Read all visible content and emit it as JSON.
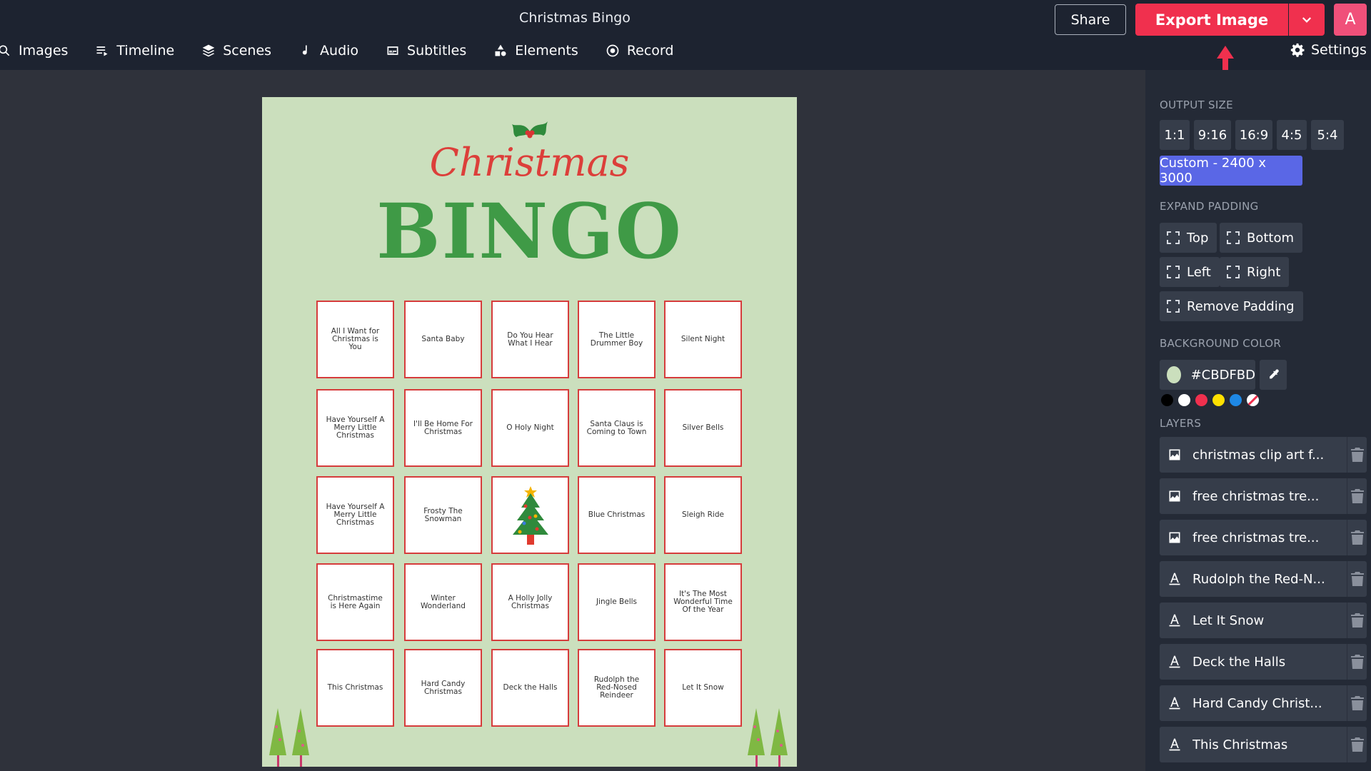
{
  "header": {
    "doc_title": "Christmas Bingo",
    "tabs": [
      {
        "label": "Images",
        "icon": "search-icon"
      },
      {
        "label": "Timeline",
        "icon": "timeline-icon"
      },
      {
        "label": "Scenes",
        "icon": "layers-icon"
      },
      {
        "label": "Audio",
        "icon": "music-note-icon"
      },
      {
        "label": "Subtitles",
        "icon": "subtitles-icon"
      },
      {
        "label": "Elements",
        "icon": "shapes-icon"
      },
      {
        "label": "Record",
        "icon": "record-icon"
      }
    ],
    "share_label": "Share",
    "export_label": "Export Image",
    "avatar_letter": "A",
    "settings_label": "Settings",
    "accent_color": "#F0304E"
  },
  "panel": {
    "output_size_label": "OUTPUT SIZE",
    "ratios": [
      "1:1",
      "9:16",
      "16:9",
      "4:5",
      "5:4"
    ],
    "custom_size": "Custom - 2400 x 3000",
    "expand_padding_label": "EXPAND PADDING",
    "padding": {
      "top": "Top",
      "bottom": "Bottom",
      "left": "Left",
      "right": "Right",
      "remove": "Remove Padding"
    },
    "background_label": "BACKGROUND COLOR",
    "background_hex": "#CBDFBD",
    "swatches": [
      "#000000",
      "#FFFFFF",
      "#F0304E",
      "#FFE000",
      "#1E88E5"
    ],
    "layers_label": "LAYERS",
    "layers": [
      {
        "name": "christmas clip art f...",
        "kind": "image"
      },
      {
        "name": "free christmas tre...",
        "kind": "image"
      },
      {
        "name": "free christmas tre...",
        "kind": "image"
      },
      {
        "name": "Rudolph the Red-N...",
        "kind": "text"
      },
      {
        "name": "Let It Snow",
        "kind": "text"
      },
      {
        "name": "Deck the Halls",
        "kind": "text"
      },
      {
        "name": "Hard Candy Christ...",
        "kind": "text"
      },
      {
        "name": "This Christmas",
        "kind": "text"
      }
    ]
  },
  "canvas": {
    "script_title": "Christmas",
    "big_title": "BINGO",
    "cells": [
      [
        "All I Want for Christmas is You",
        "Santa Baby",
        "Do You Hear What I Hear",
        "The Little Drummer Boy",
        "Silent Night"
      ],
      [
        "Have Yourself A Merry Little Christmas",
        "I'll Be Home For Christmas",
        "O Holy Night",
        "Santa Claus is Coming to Town",
        "Silver Bells"
      ],
      [
        "Have Yourself A Merry Little Christmas",
        "Frosty The Snowman",
        "",
        "Blue Christmas",
        "Sleigh Ride"
      ],
      [
        "Christmastime is Here Again",
        "Winter Wonderland",
        "A Holly Jolly Christmas",
        "Jingle Bells",
        "It's The Most Wonderful Time Of the Year"
      ],
      [
        "This Christmas",
        "Hard Candy Christmas",
        "Deck the Halls",
        "Rudolph the Red-Nosed Reindeer",
        "Let It Snow"
      ]
    ]
  }
}
